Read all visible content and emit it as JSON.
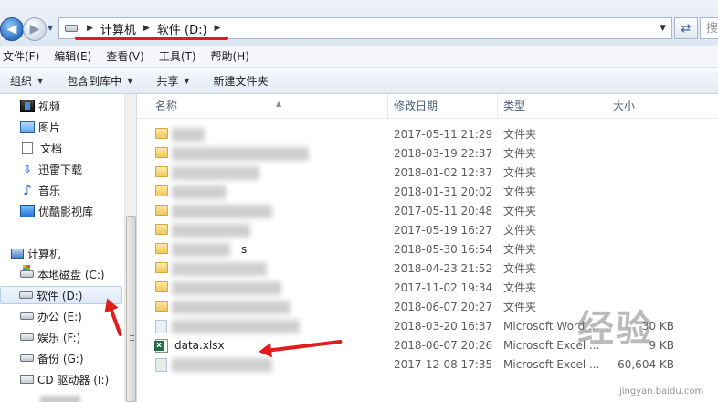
{
  "address": {
    "crumbs": [
      "计算机",
      "软件 (D:)"
    ],
    "search_placeholder": "搜"
  },
  "menu": [
    "文件(F)",
    "编辑(E)",
    "查看(V)",
    "工具(T)",
    "帮助(H)"
  ],
  "toolbar": [
    "组织",
    "包含到库中",
    "共享",
    "新建文件夹"
  ],
  "sidebar": {
    "libraries": [
      "视频",
      "图片",
      "文档",
      "迅雷下载",
      "音乐",
      "优酷影视库"
    ],
    "computer_label": "计算机",
    "drives": [
      "本地磁盘 (C:)",
      "软件 (D:)",
      "办公 (E:)",
      "娱乐 (F:)",
      "备份 (G:)",
      "CD 驱动器 (I:)"
    ],
    "selected_drive": "软件 (D:)"
  },
  "columns": {
    "name": "名称",
    "date": "修改日期",
    "type": "类型",
    "size": "大小"
  },
  "files": [
    {
      "name": "",
      "date": "2017-05-11 21:29",
      "type": "文件夹",
      "size": ""
    },
    {
      "name": "",
      "date": "2018-03-19 22:37",
      "type": "文件夹",
      "size": ""
    },
    {
      "name": "",
      "date": "2018-01-02 12:37",
      "type": "文件夹",
      "size": ""
    },
    {
      "name": "",
      "date": "2018-01-31 20:02",
      "type": "文件夹",
      "size": ""
    },
    {
      "name": "",
      "date": "2017-05-11 20:48",
      "type": "文件夹",
      "size": ""
    },
    {
      "name": "",
      "date": "2017-05-19 16:27",
      "type": "文件夹",
      "size": ""
    },
    {
      "name": "s",
      "date": "2018-05-30 16:54",
      "type": "文件夹",
      "size": ""
    },
    {
      "name": "",
      "date": "2018-04-23 21:52",
      "type": "文件夹",
      "size": ""
    },
    {
      "name": "",
      "date": "2017-11-02 19:34",
      "type": "文件夹",
      "size": ""
    },
    {
      "name": "",
      "date": "2018-06-07 20:27",
      "type": "文件夹",
      "size": ""
    },
    {
      "name": "",
      "date": "2018-03-20 16:37",
      "type": "Microsoft Word ...",
      "size": "30 KB"
    },
    {
      "name": "data.xlsx",
      "date": "2018-06-07 20:26",
      "type": "Microsoft Excel ...",
      "size": "9 KB"
    },
    {
      "name": "",
      "date": "2017-12-08 17:35",
      "type": "Microsoft Excel ...",
      "size": "60,604 KB"
    }
  ],
  "watermark": {
    "text": "经验",
    "url": "jingyan.baidu.com"
  },
  "colors": {
    "annotation_red": "#e21c1c",
    "accent_blue": "#2a6fc4"
  }
}
